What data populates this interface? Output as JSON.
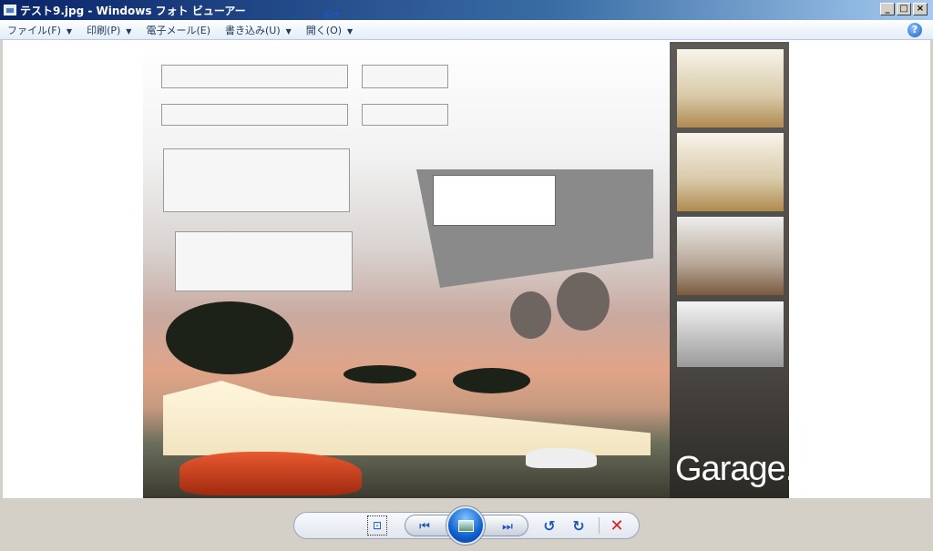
{
  "window": {
    "title": "テスト9.jpg - Windows フォト ビューアー",
    "minimize": "0",
    "maximize": "1",
    "close": "r"
  },
  "menu": [
    {
      "label": "ファイル(F)",
      "dropdown": true
    },
    {
      "label": "印刷(P)",
      "dropdown": true
    },
    {
      "label": "電子メール(E)",
      "dropdown": false
    },
    {
      "label": "書き込み(U)",
      "dropdown": true
    },
    {
      "label": "開く(O)",
      "dropdown": true
    }
  ],
  "help_label": "?",
  "photo": {
    "caption": "Garage."
  },
  "toolbar": {
    "zoom": "zoom-icon",
    "fit": "fit-to-window-icon",
    "prev": "previous-icon",
    "slideshow": "slideshow-icon",
    "next": "next-icon",
    "rotate_ccw": "rotate-counterclockwise-icon",
    "rotate_cw": "rotate-clockwise-icon",
    "delete": "delete-icon"
  },
  "colors": {
    "title_bar": "#0a246a",
    "accent": "#1b56b8",
    "delete": "#d42020"
  }
}
